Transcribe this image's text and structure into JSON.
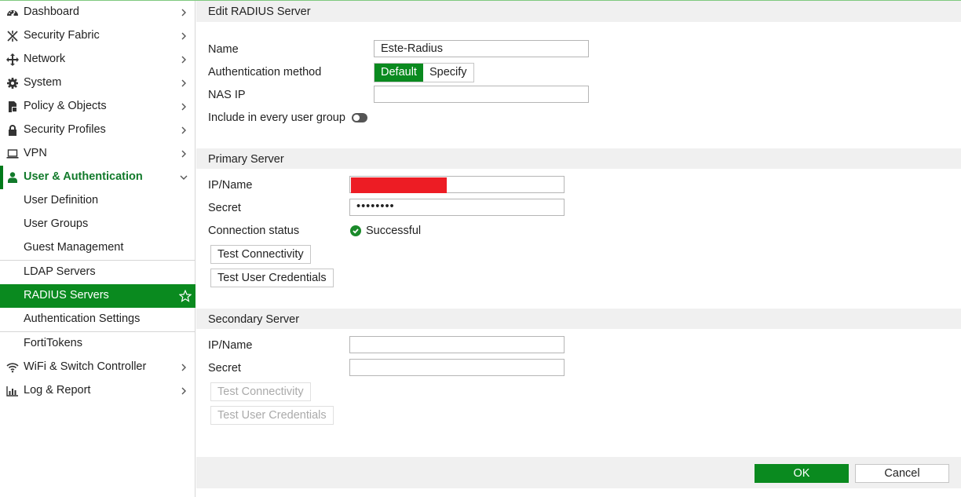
{
  "sidebar": {
    "items": [
      {
        "label": "Dashboard",
        "icon": "dashboard-icon"
      },
      {
        "label": "Security Fabric",
        "icon": "security-fabric-icon"
      },
      {
        "label": "Network",
        "icon": "network-icon"
      },
      {
        "label": "System",
        "icon": "gear-icon"
      },
      {
        "label": "Policy & Objects",
        "icon": "policy-icon"
      },
      {
        "label": "Security Profiles",
        "icon": "lock-icon"
      },
      {
        "label": "VPN",
        "icon": "laptop-icon"
      },
      {
        "label": "User & Authentication",
        "icon": "user-icon"
      },
      {
        "label": "User Definition"
      },
      {
        "label": "User Groups"
      },
      {
        "label": "Guest Management"
      },
      {
        "label": "LDAP Servers"
      },
      {
        "label": "RADIUS Servers"
      },
      {
        "label": "Authentication Settings"
      },
      {
        "label": "FortiTokens"
      },
      {
        "label": "WiFi & Switch Controller",
        "icon": "wifi-icon"
      },
      {
        "label": "Log & Report",
        "icon": "chart-icon"
      }
    ]
  },
  "header": {
    "title": "Edit RADIUS Server"
  },
  "form": {
    "name_label": "Name",
    "name_value": "Este-Radius",
    "auth_method_label": "Authentication method",
    "auth_default": "Default",
    "auth_specify": "Specify",
    "nas_ip_label": "NAS IP",
    "nas_ip_value": "",
    "include_label": "Include in every user group"
  },
  "primary": {
    "title": "Primary Server",
    "ip_label": "IP/Name",
    "secret_label": "Secret",
    "secret_value": "••••••••",
    "conn_label": "Connection status",
    "conn_value": "Successful",
    "test_conn": "Test Connectivity",
    "test_user": "Test User Credentials"
  },
  "secondary": {
    "title": "Secondary Server",
    "ip_label": "IP/Name",
    "secret_label": "Secret",
    "test_conn": "Test Connectivity",
    "test_user": "Test User Credentials"
  },
  "footer": {
    "ok": "OK",
    "cancel": "Cancel"
  },
  "colors": {
    "accent": "#0a8a1f",
    "redaction": "#ed1c24"
  }
}
